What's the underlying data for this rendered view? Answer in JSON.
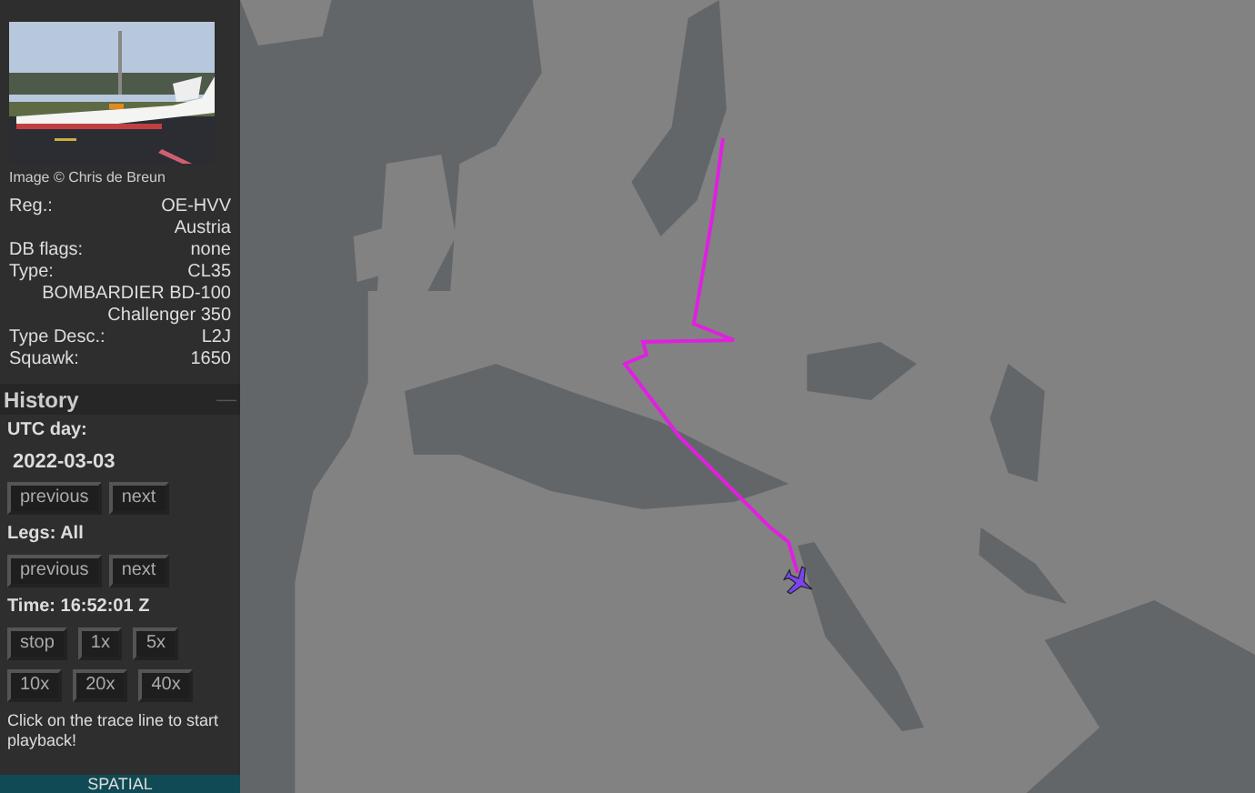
{
  "photo": {
    "kind": "picture",
    "credit": "Image © Chris de Breun"
  },
  "details": [
    {
      "label": "Reg.:",
      "value": "OE-HVV"
    },
    {
      "value": "Austria"
    },
    {
      "label": "DB flags:",
      "value": "none"
    },
    {
      "label": "Type:",
      "value": "CL35"
    },
    {
      "value": "BOMBARDIER BD-100 Challenger 350"
    },
    {
      "label": "Type Desc.:",
      "value": "L2J"
    },
    {
      "label": "Squawk:",
      "value": "1650"
    }
  ],
  "history": {
    "title": "History",
    "collapse": "—",
    "utc_day_label": "UTC day:",
    "utc_day": "2022-03-03",
    "day_buttons": [
      "previous",
      "next"
    ],
    "legs_label": "Legs: All",
    "leg_buttons": [
      "previous",
      "next"
    ],
    "time_label": "Time: 16:52:01 Z",
    "speed_rows": [
      [
        "stop",
        "1x",
        "5x"
      ],
      [
        "10x",
        "20x",
        "40x"
      ]
    ],
    "hint": "Click on the trace line to start playback!"
  },
  "footer": "SPATIAL"
}
